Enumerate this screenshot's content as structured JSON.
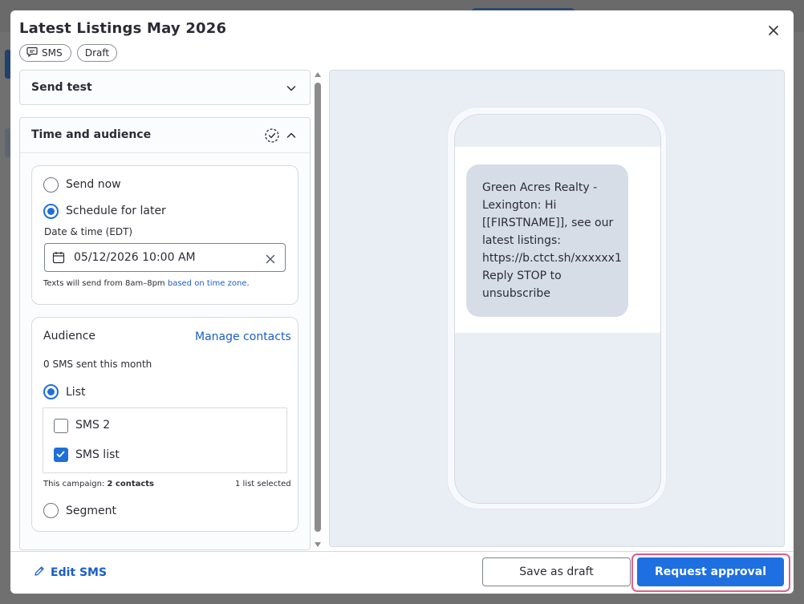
{
  "modal": {
    "title": "Latest Listings May 2026",
    "close_icon": "close-icon",
    "tags": {
      "sms": "SMS",
      "draft": "Draft"
    }
  },
  "send_test": {
    "title": "Send test",
    "icon": "chevron-down-icon"
  },
  "time_audience": {
    "title": "Time and audience",
    "status_icon": "dashed-check-circle-icon",
    "toggle_icon": "chevron-up-icon",
    "schedule": {
      "send_now": "Send now",
      "schedule_later": "Schedule for later",
      "selected": "schedule_later",
      "date_label": "Date & time (EDT)",
      "date_value": "05/12/2026 10:00 AM",
      "note_prefix": "Texts will send from 8am–8pm ",
      "note_link": "based on time zone",
      "note_suffix": "."
    },
    "audience": {
      "title": "Audience",
      "manage_link": "Manage contacts",
      "sent_count": "0 SMS sent this month",
      "list_option": "List",
      "lists": [
        {
          "name": "SMS 2",
          "checked": false
        },
        {
          "name": "SMS list",
          "checked": true
        }
      ],
      "campaign_prefix": "This campaign: ",
      "campaign_count": "2 contacts",
      "lists_selected": "1 list selected",
      "segment_option": "Segment"
    }
  },
  "preview": {
    "message_lines": [
      "Green Acres Realty -",
      "Lexington: Hi",
      "[[FIRSTNAME]], see our",
      "latest listings:"
    ],
    "message_link": "https://b.ctct.sh/xxxxxx1",
    "message_tail": [
      "Reply STOP to",
      "unsubscribe"
    ]
  },
  "footer": {
    "edit_label": "Edit SMS",
    "edit_icon": "pencil-icon",
    "save_draft": "Save as draft",
    "request_approval": "Request approval"
  },
  "colors": {
    "accent": "#1e6fe0",
    "highlight_outline": "#e05d8c",
    "bubble": "#d7dde6"
  }
}
